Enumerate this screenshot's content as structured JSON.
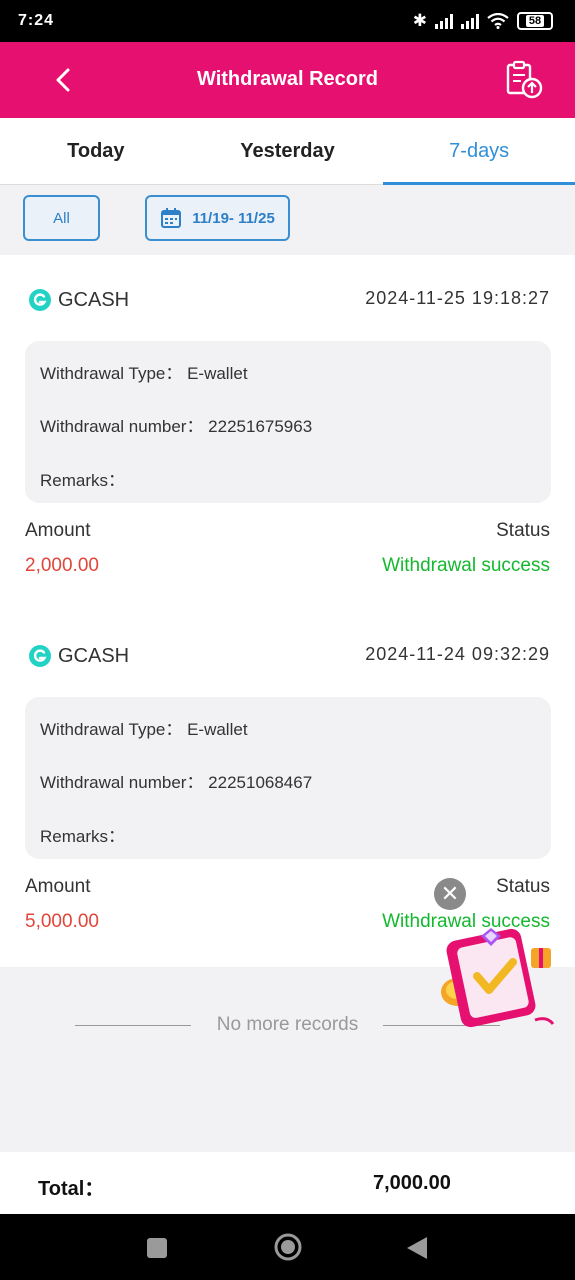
{
  "status_bar": {
    "time": "7:24",
    "battery": "58"
  },
  "header": {
    "title": "Withdrawal Record",
    "back_icon": "chevron-left-icon",
    "record_icon": "clipboard-upload-icon"
  },
  "tabs": [
    {
      "label": "Today",
      "active": false
    },
    {
      "label": "Yesterday",
      "active": false
    },
    {
      "label": "7-days",
      "active": true
    }
  ],
  "filters": {
    "all_label": "All",
    "date_range": "11/19- 11/25"
  },
  "records": [
    {
      "channel": "GCASH",
      "datetime": "2024-11-25 19:18:27",
      "type_line": "Withdrawal Type： E-wallet",
      "number_line": "Withdrawal number： 22251675963",
      "remarks_line": "Remarks：",
      "amount_label": "Amount",
      "status_label": "Status",
      "amount": "2,000.00",
      "status": "Withdrawal success"
    },
    {
      "channel": "GCASH",
      "datetime": "2024-11-24 09:32:29",
      "type_line": "Withdrawal Type： E-wallet",
      "number_line": "Withdrawal number： 22251068467",
      "remarks_line": "Remarks：",
      "amount_label": "Amount",
      "status_label": "Status",
      "amount": "5,000.00",
      "status": "Withdrawal success"
    }
  ],
  "no_more": "No more records",
  "total": {
    "label": "Total：",
    "value": "7,000.00"
  },
  "colors": {
    "header": "#e5106f",
    "accent": "#2f8fd8",
    "amount": "#e2453a",
    "success": "#14b82f"
  }
}
